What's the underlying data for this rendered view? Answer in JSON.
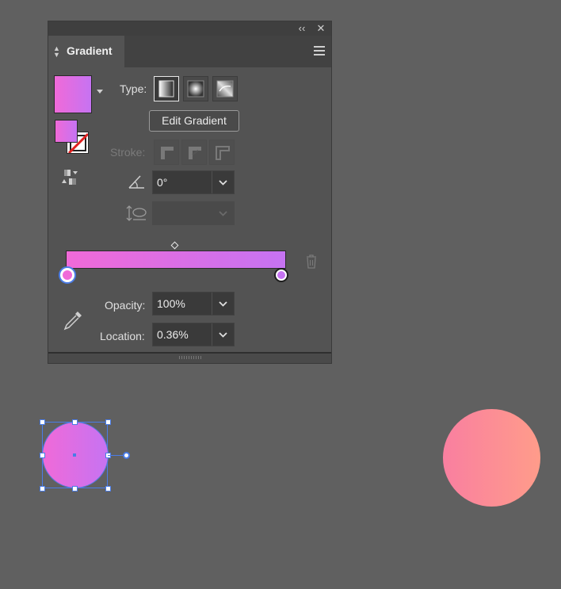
{
  "panel": {
    "title": "Gradient",
    "type_label": "Type:",
    "edit_gradient_label": "Edit Gradient",
    "stroke_label": "Stroke:",
    "angle_value": "0°",
    "opacity_label": "Opacity:",
    "opacity_value": "100%",
    "location_label": "Location:",
    "location_value": "0.36%"
  },
  "gradient": {
    "start_color": "#f06ad8",
    "end_color": "#c673f2",
    "selected_stop": "left"
  },
  "canvas": {
    "selected_circle_fill": [
      "#f06ad8",
      "#c673f2"
    ],
    "other_circle_fill": [
      "#f97fa0",
      "#ff9c8a"
    ],
    "selection_color": "#4a7ce6",
    "background": "#606060"
  },
  "icons": {
    "collapse": "collapse-icon",
    "close": "close-icon",
    "menu": "panel-menu-icon",
    "angle": "angle-icon",
    "aspect": "aspect-ratio-icon",
    "eyedropper": "eyedropper-icon",
    "trash": "trash-icon"
  }
}
